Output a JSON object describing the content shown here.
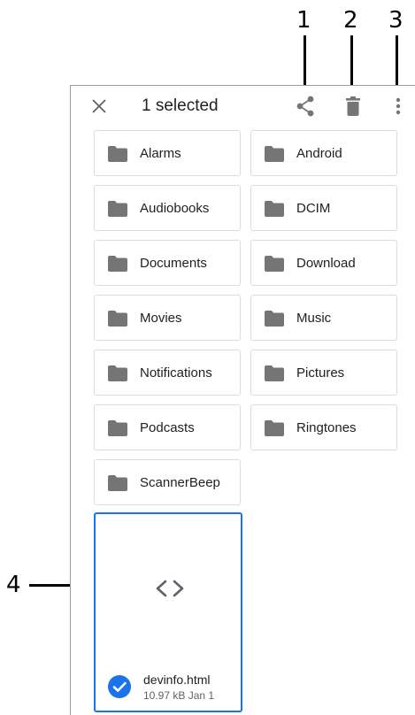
{
  "callouts": [
    "1",
    "2",
    "3",
    "4"
  ],
  "toolbar": {
    "close_icon": "close-icon",
    "title": "1 selected",
    "share_icon": "share-icon",
    "delete_icon": "delete-icon",
    "more_icon": "more-vert-icon"
  },
  "folders": [
    {
      "label": "Alarms",
      "icon": "folder-icon"
    },
    {
      "label": "Android",
      "icon": "folder-icon"
    },
    {
      "label": "Audiobooks",
      "icon": "folder-icon"
    },
    {
      "label": "DCIM",
      "icon": "folder-icon"
    },
    {
      "label": "Documents",
      "icon": "folder-icon"
    },
    {
      "label": "Download",
      "icon": "folder-icon"
    },
    {
      "label": "Movies",
      "icon": "folder-icon"
    },
    {
      "label": "Music",
      "icon": "folder-icon"
    },
    {
      "label": "Notifications",
      "icon": "folder-icon"
    },
    {
      "label": "Pictures",
      "icon": "folder-icon"
    },
    {
      "label": "Podcasts",
      "icon": "folder-icon"
    },
    {
      "label": "Ringtones",
      "icon": "folder-icon"
    },
    {
      "label": "ScannerBeep",
      "icon": "folder-icon"
    }
  ],
  "file": {
    "name": "devinfo.html",
    "meta": "10.97 kB Jan 1",
    "preview_icon": "code-icon",
    "selected": true,
    "check_icon": "check-circle-icon"
  },
  "colors": {
    "accent": "#1a73e8",
    "icon_gray": "#757575",
    "card_border": "#dadce0"
  }
}
